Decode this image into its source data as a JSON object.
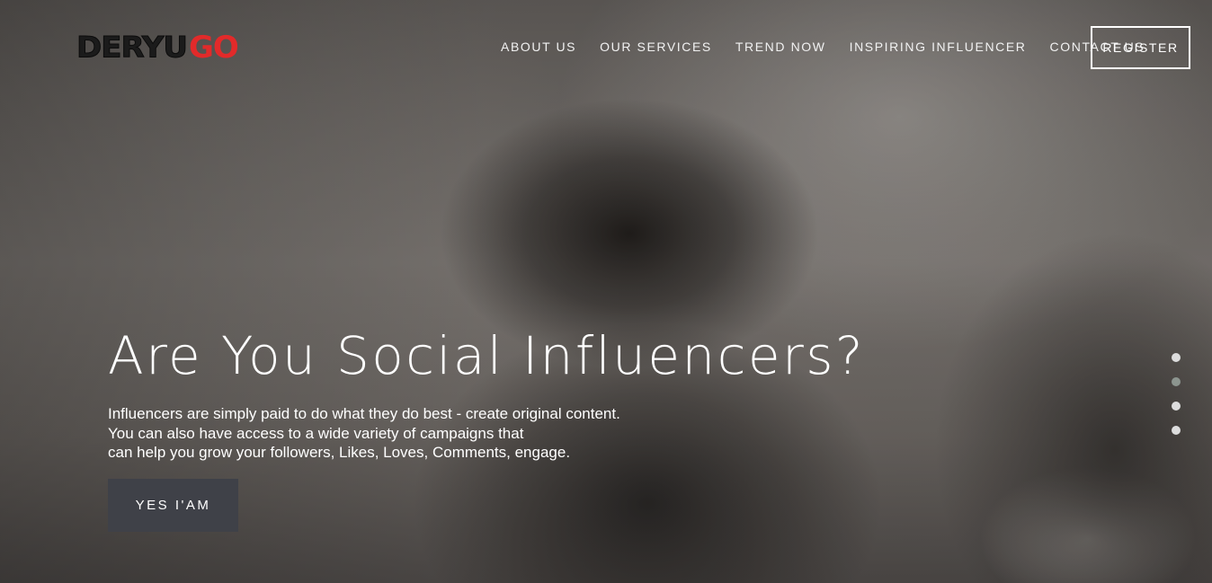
{
  "brand": {
    "logo_part1": "DERYU",
    "logo_part2": "GO",
    "accent_color": "#e22a2a"
  },
  "nav": {
    "items": [
      {
        "label": "ABOUT US"
      },
      {
        "label": "OUR SERVICES"
      },
      {
        "label": "TREND NOW"
      },
      {
        "label": "INSPIRING INFLUENCER"
      },
      {
        "label": "CONTACT US"
      }
    ],
    "register_label": "REGISTER"
  },
  "hero": {
    "title": "Are You Social Influencers?",
    "description_lines": [
      "Influencers are simply paid to do what they do best - create original content.",
      "You can also have access to a wide variety of campaigns that",
      "can help you grow your followers, Likes, Loves, Comments, engage."
    ],
    "cta_label": "YES I'AM",
    "cta_color": "#3f4148"
  },
  "slider": {
    "dot_count": 4,
    "active_index": 1
  }
}
